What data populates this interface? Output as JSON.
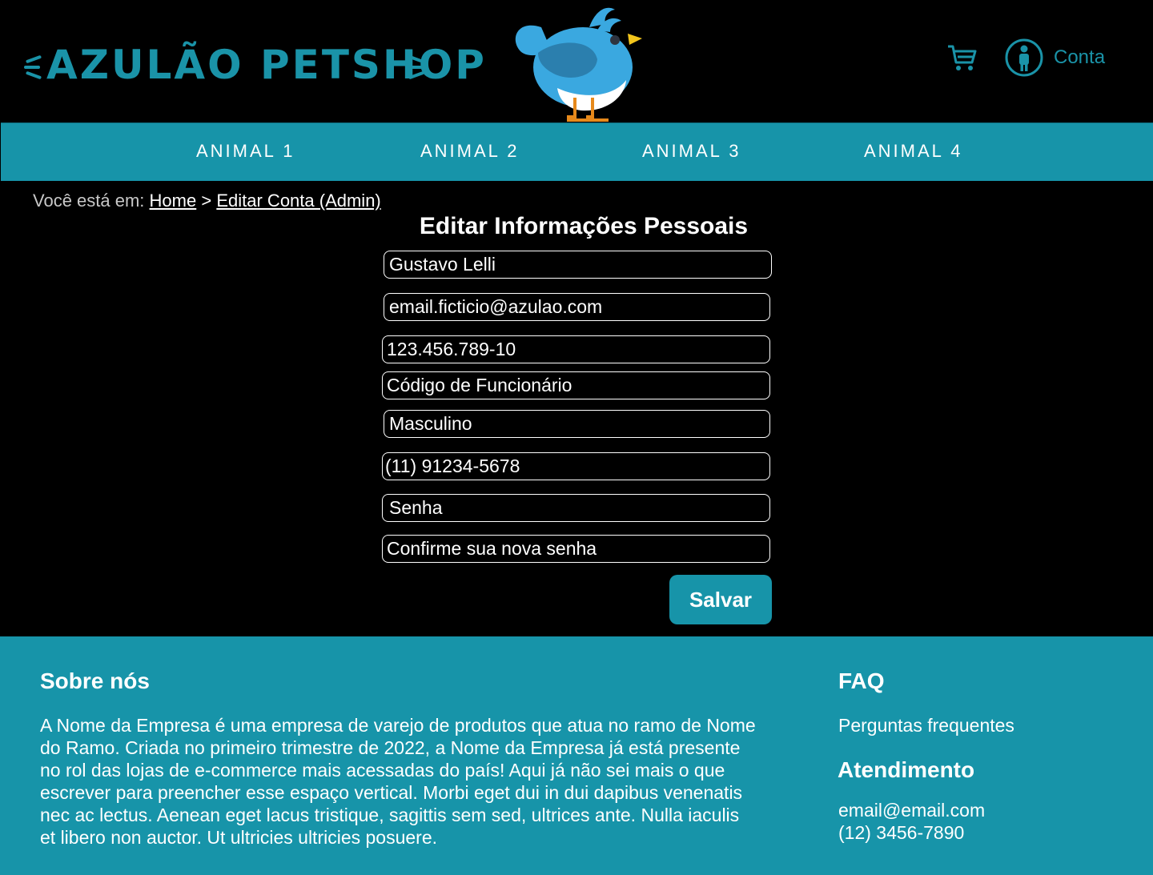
{
  "header": {
    "logo_text": "AZULÃO PETSHOP",
    "account_label": "Conta",
    "brand_color": "#1794a9",
    "icons": [
      "cart-icon",
      "account-icon",
      "bird-mascot"
    ]
  },
  "nav": {
    "items": [
      {
        "label": "ANIMAL 1"
      },
      {
        "label": "ANIMAL 2"
      },
      {
        "label": "ANIMAL 3"
      },
      {
        "label": "ANIMAL 4"
      }
    ]
  },
  "breadcrumb": {
    "prefix": "Você está em:",
    "home": "Home",
    "separator": ">",
    "current": "Editar Conta (Admin)"
  },
  "form": {
    "title": "Editar Informações Pessoais",
    "fields": {
      "name": {
        "value": "Gustavo Lelli"
      },
      "email": {
        "value": "email.ficticio@azulao.com"
      },
      "cpf": {
        "value": "123.456.789-10"
      },
      "employee_code": {
        "placeholder": "Código de Funcionário"
      },
      "gender": {
        "value": "Masculino"
      },
      "phone": {
        "value": "(11) 91234-5678"
      },
      "password": {
        "placeholder": "Senha"
      },
      "confirm_password": {
        "placeholder": "Confirme sua nova senha"
      }
    },
    "save_label": "Salvar"
  },
  "footer": {
    "about_title": "Sobre nós",
    "about_lines": [
      "A Nome da Empresa é uma empresa de varejo de produtos que atua no ramo de Nome",
      "do Ramo. Criada no primeiro trimestre de 2022, a Nome da Empresa já está presente",
      "no rol das  lojas de e-commerce mais acessadas do país! Aqui já não sei mais o que",
      "escrever para preencher esse espaço vertical. Morbi eget dui in dui dapibus venenatis",
      "nec ac lectus. Aenean eget lacus tristique, sagittis sem sed, ultrices ante. Nulla iaculis",
      "et libero non auctor. Ut ultricies ultricies posuere."
    ],
    "faq_title": "FAQ",
    "faq_link": "Perguntas frequentes",
    "support_title": "Atendimento",
    "support_email": "email@email.com",
    "support_phone": "(12) 3456-7890"
  }
}
